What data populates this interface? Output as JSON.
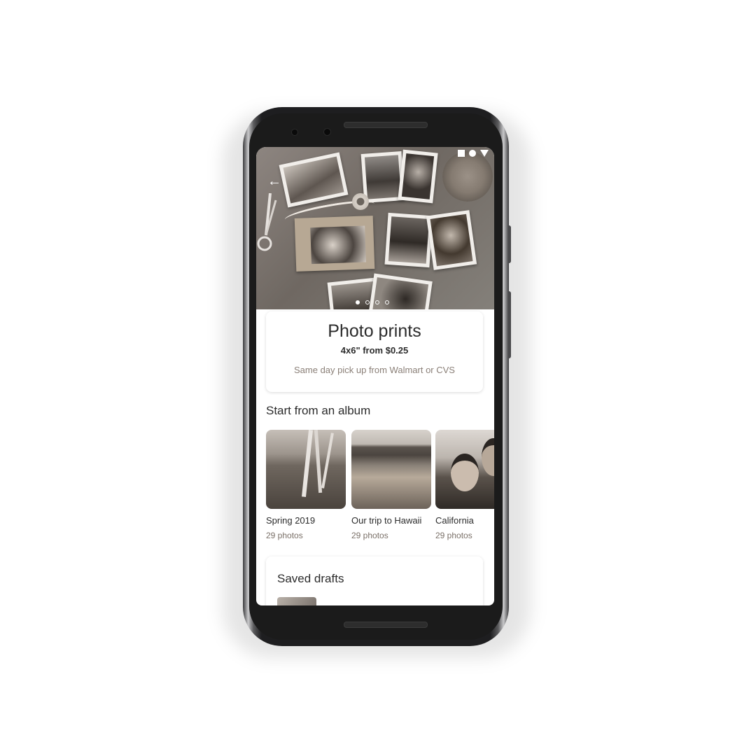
{
  "product_card": {
    "title": "Photo prints",
    "price": "4x6\" from $0.25",
    "subtitle": "Same day pick up from Walmart or CVS"
  },
  "albums_section": {
    "title": "Start from an album",
    "albums": [
      {
        "name": "Spring 2019",
        "count": "29 photos"
      },
      {
        "name": "Our trip to Hawaii",
        "count": "29 photos"
      },
      {
        "name": "California",
        "count": "29 photos"
      }
    ]
  },
  "drafts_section": {
    "title": "Saved drafts"
  },
  "carousel": {
    "total": 4,
    "active": 1
  },
  "icons": {
    "back": "arrow-back-icon",
    "status": [
      "square-icon",
      "circle-icon",
      "triangle-icon"
    ]
  },
  "colors": {
    "text_primary": "#2b2b2b",
    "text_secondary": "#8a7f77"
  }
}
